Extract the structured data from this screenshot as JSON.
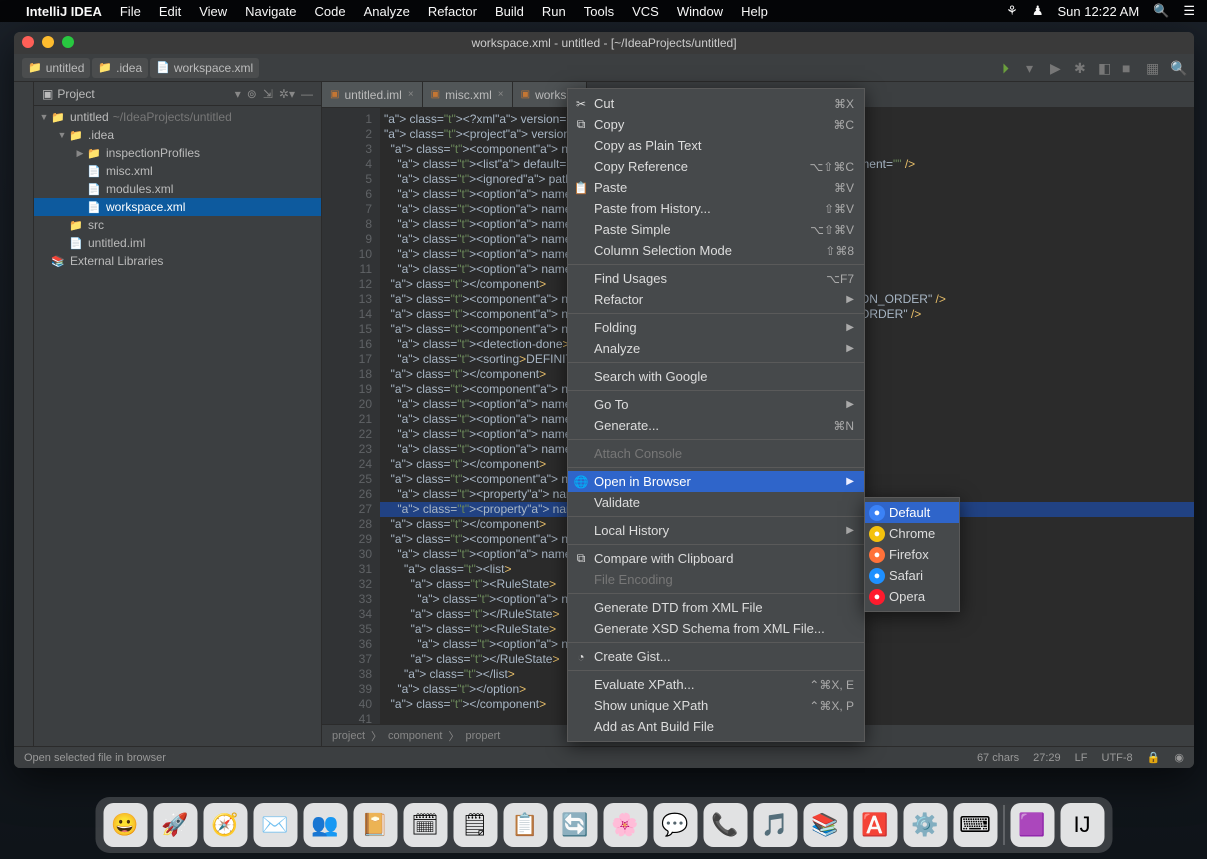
{
  "menubar": {
    "app": "IntelliJ IDEA",
    "items": [
      "File",
      "Edit",
      "View",
      "Navigate",
      "Code",
      "Analyze",
      "Refactor",
      "Build",
      "Run",
      "Tools",
      "VCS",
      "Window",
      "Help"
    ],
    "clock": "Sun 12:22 AM"
  },
  "window": {
    "title": "workspace.xml - untitled - [~/IdeaProjects/untitled]"
  },
  "breadcrumbs": [
    {
      "icon": "📁",
      "label": "untitled"
    },
    {
      "icon": "📁",
      "label": ".idea"
    },
    {
      "icon": "📄",
      "label": "workspace.xml"
    }
  ],
  "project_header": {
    "label": "Project"
  },
  "tree": [
    {
      "depth": 0,
      "arrow": "▼",
      "icon": "📁",
      "label": "untitled",
      "path": "~/IdeaProjects/untitled"
    },
    {
      "depth": 1,
      "arrow": "▼",
      "icon": "📁",
      "label": ".idea"
    },
    {
      "depth": 2,
      "arrow": "▶",
      "icon": "📁",
      "label": "inspectionProfiles"
    },
    {
      "depth": 2,
      "arrow": "",
      "icon": "📄",
      "label": "misc.xml"
    },
    {
      "depth": 2,
      "arrow": "",
      "icon": "📄",
      "label": "modules.xml"
    },
    {
      "depth": 2,
      "arrow": "",
      "icon": "📄",
      "label": "workspace.xml",
      "selected": true
    },
    {
      "depth": 1,
      "arrow": "",
      "icon": "📁",
      "label": "src"
    },
    {
      "depth": 1,
      "arrow": "",
      "icon": "📄",
      "label": "untitled.iml"
    },
    {
      "depth": 0,
      "arrow": "",
      "icon": "📚",
      "label": "External Libraries"
    }
  ],
  "tabs": [
    {
      "label": "untitled.iml"
    },
    {
      "label": "misc.xml"
    },
    {
      "label": "works"
    }
  ],
  "gutter_lines": [
    "1",
    "2",
    "3",
    "4",
    "5",
    "6",
    "7",
    "8",
    "9",
    "10",
    "11",
    "12",
    "13",
    "14",
    "15",
    "16",
    "17",
    "18",
    "19",
    "20",
    "21",
    "22",
    "23",
    "24",
    "25",
    "26",
    "27",
    "28",
    "29",
    "30",
    "31",
    "32",
    "33",
    "34",
    "35",
    "36",
    "37",
    "38",
    "39",
    "40",
    "41"
  ],
  "code": [
    "<?xml version=\"1.0\" encoding",
    "<project version=\"4\">",
    "  <component name=\"ChangeLis",
    "    <list default=\"true\" id=                                    =\"Default\" comment=\"\" />",
    "    <ignored path=\"$PROJECT_",
    "    <option name=\"EXCLUDED_C",
    "    <option name=\"TRACKING_E",
    "    <option name=\"SHOW_DIALO",
    "    <option name=\"HIGHLIGHT_",
    "    <option name=\"HIGHLIGHT_",
    "    <option name=\"LAST_RESOL",
    "  </component>",
    "  <component name=\"JsBuildTo                               orting=\"DEFINITION_ORDER\" />",
    "  <component name=\"JsBuildTo                                    =\"DEFINITION_ORDER\" />",
    "  <component name=\"JsGulpfil",
    "    <detection-done>true</de",
    "    <sorting>DEFINITION_ORDE",
    "  </component>",
    "  <component name=\"ProjectFr",
    "    <option name=\"x\" value=\"",
    "    <option name=\"y\" value=\"",
    "    <option name=\"width\" val",
    "    <option name=\"height\" va",
    "  </component>",
    "  <component name=\"Propertie",
    "    <property name=\"WebServe",
    "    <property name=\"aspect.p",
    "  </component>",
    "  <component name=\"RunDashbo",
    "    <option name=\"ruleStates",
    "      <list>",
    "        <RuleState>",
    "          <option name=\"name                              option name=\"name",
    "        </RuleState>",
    "        <RuleState>",
    "          <option name=\"name                              option name=\"name",
    "        </RuleState>",
    "      </list>",
    "    </option>",
    "  </component>",
    ""
  ],
  "bottom_crumbs": [
    "project",
    "component",
    "propert"
  ],
  "status": {
    "hint": "Open selected file in browser",
    "chars": "67 chars",
    "pos": "27:29",
    "sep": "LF",
    "enc": "UTF-8"
  },
  "context_menu": [
    {
      "label": "Cut",
      "shortcut": "⌘X",
      "icon": "✂"
    },
    {
      "label": "Copy",
      "shortcut": "⌘C",
      "icon": "⧉"
    },
    {
      "label": "Copy as Plain Text"
    },
    {
      "label": "Copy Reference",
      "shortcut": "⌥⇧⌘C"
    },
    {
      "label": "Paste",
      "shortcut": "⌘V",
      "icon": "📋"
    },
    {
      "label": "Paste from History...",
      "shortcut": "⇧⌘V"
    },
    {
      "label": "Paste Simple",
      "shortcut": "⌥⇧⌘V"
    },
    {
      "label": "Column Selection Mode",
      "shortcut": "⇧⌘8"
    },
    {
      "sep": true
    },
    {
      "label": "Find Usages",
      "shortcut": "⌥F7"
    },
    {
      "label": "Refactor",
      "sub": "▶"
    },
    {
      "sep": true
    },
    {
      "label": "Folding",
      "sub": "▶"
    },
    {
      "label": "Analyze",
      "sub": "▶"
    },
    {
      "sep": true
    },
    {
      "label": "Search with Google"
    },
    {
      "sep": true
    },
    {
      "label": "Go To",
      "sub": "▶"
    },
    {
      "label": "Generate...",
      "shortcut": "⌘N"
    },
    {
      "sep": true
    },
    {
      "label": "Attach Console",
      "disabled": true
    },
    {
      "sep": true
    },
    {
      "label": "Open in Browser",
      "sub": "▶",
      "hl": true,
      "icon": "🌐"
    },
    {
      "label": "Validate"
    },
    {
      "sep": true
    },
    {
      "label": "Local History",
      "sub": "▶"
    },
    {
      "sep": true
    },
    {
      "label": "Compare with Clipboard",
      "icon": "⧉"
    },
    {
      "label": "File Encoding",
      "disabled": true
    },
    {
      "sep": true
    },
    {
      "label": "Generate DTD from XML File"
    },
    {
      "label": "Generate XSD Schema from XML File..."
    },
    {
      "sep": true
    },
    {
      "label": "Create Gist...",
      "icon": "◔"
    },
    {
      "sep": true
    },
    {
      "label": "Evaluate XPath...",
      "shortcut": "⌃⌘X, E"
    },
    {
      "label": "Show unique XPath",
      "shortcut": "⌃⌘X, P"
    },
    {
      "label": "Add as Ant Build File"
    }
  ],
  "submenu": [
    {
      "label": "Default",
      "color": "#3b82f6",
      "hl": true
    },
    {
      "label": "Chrome",
      "color": "#f4c20d"
    },
    {
      "label": "Firefox",
      "color": "#ff7139"
    },
    {
      "label": "Safari",
      "color": "#1e90ff"
    },
    {
      "label": "Opera",
      "color": "#ff1b2d"
    }
  ],
  "dock": [
    "😀",
    "🚀",
    "🧭",
    "✉️",
    "👥",
    "📔",
    "🗓",
    "🗒",
    "📋",
    "🔄",
    "🌸",
    "💬",
    "📞",
    "🎵",
    "📚",
    "🅰️",
    "⚙️",
    "⌨",
    "🟪",
    "IJ"
  ]
}
